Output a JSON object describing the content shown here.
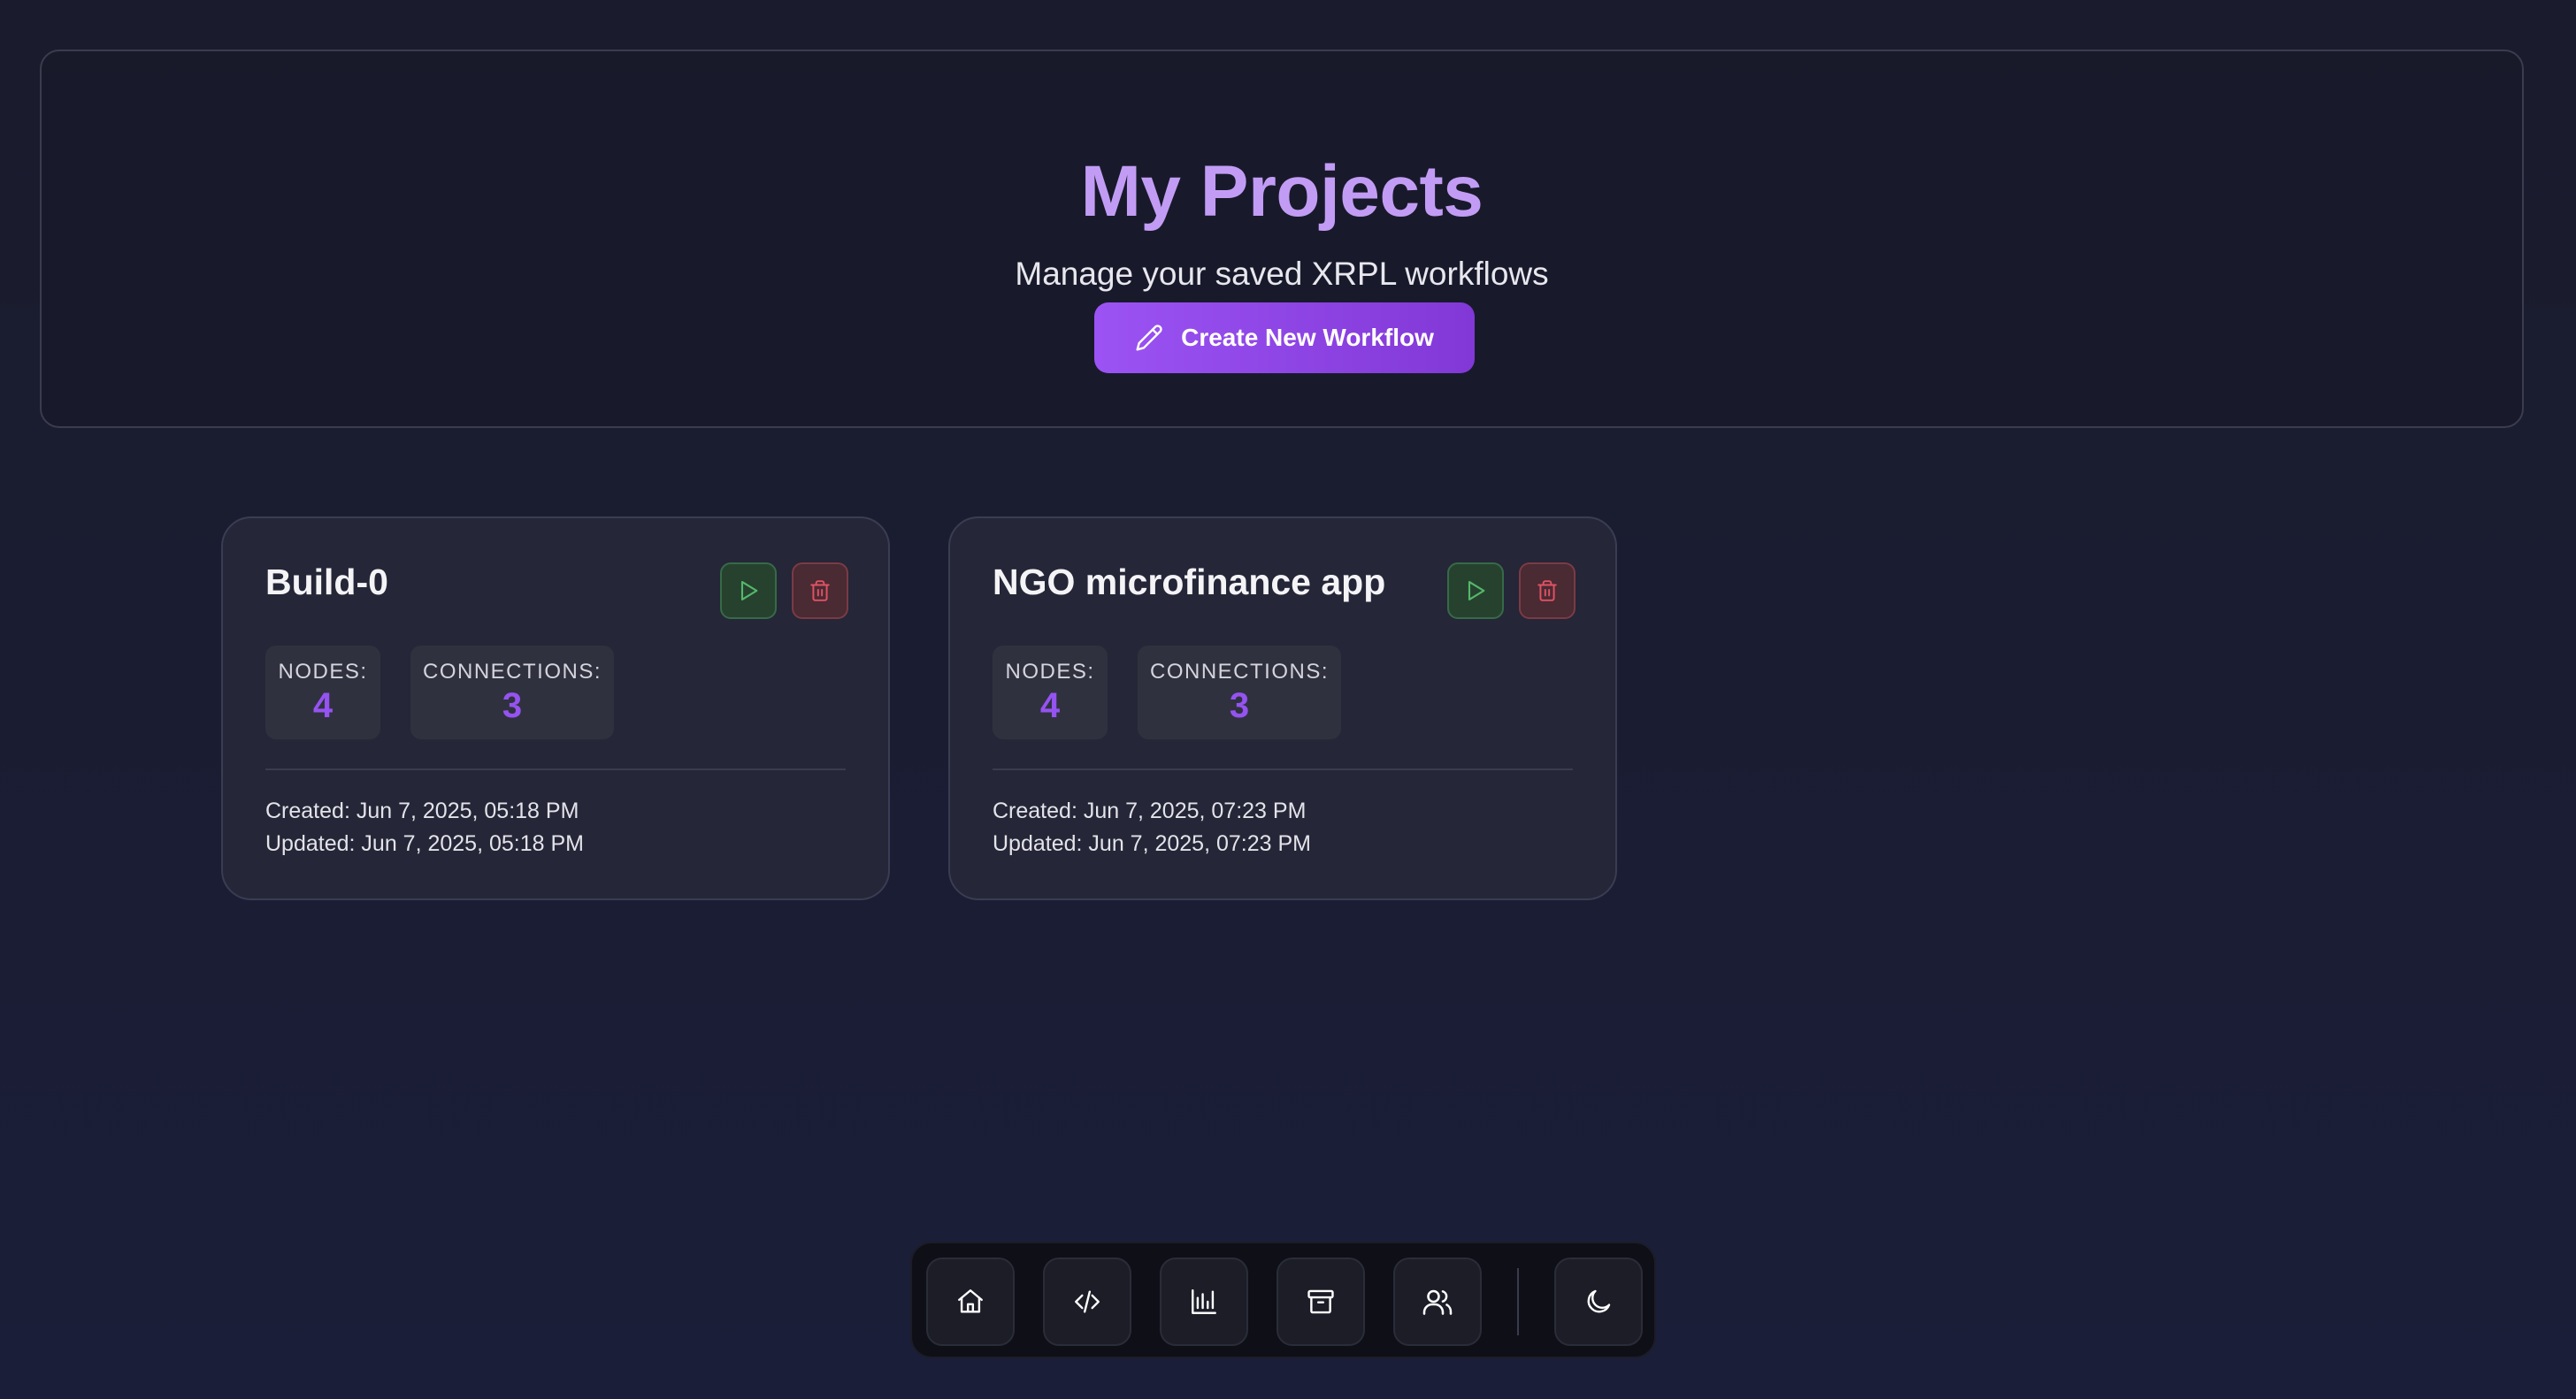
{
  "header": {
    "title": "My Projects",
    "subtitle": "Manage your saved XRPL workflows",
    "create_button_label": "Create New Workflow",
    "create_button_icon": "pencil-icon"
  },
  "projects": [
    {
      "name": "Build-0",
      "nodes_label": "NODES:",
      "nodes": "4",
      "connections_label": "CONNECTIONS:",
      "connections": "3",
      "created": "Created: Jun 7, 2025, 05:18 PM",
      "updated": "Updated: Jun 7, 2025, 05:18 PM"
    },
    {
      "name": "NGO microfinance app",
      "nodes_label": "NODES:",
      "nodes": "4",
      "connections_label": "CONNECTIONS:",
      "connections": "3",
      "created": "Created: Jun 7, 2025, 07:23 PM",
      "updated": "Updated: Jun 7, 2025, 07:23 PM"
    }
  ],
  "card_actions": {
    "run_icon": "play-icon",
    "delete_icon": "trash-icon"
  },
  "dock": {
    "items": [
      "home-icon",
      "code-icon",
      "chart-icon",
      "archive-icon",
      "users-icon",
      "moon-icon"
    ]
  },
  "colors": {
    "background": "#1a1b2c",
    "accent": "#9553f0",
    "title": "#c29cf4",
    "run": "#4caf50",
    "delete": "#e05263"
  }
}
